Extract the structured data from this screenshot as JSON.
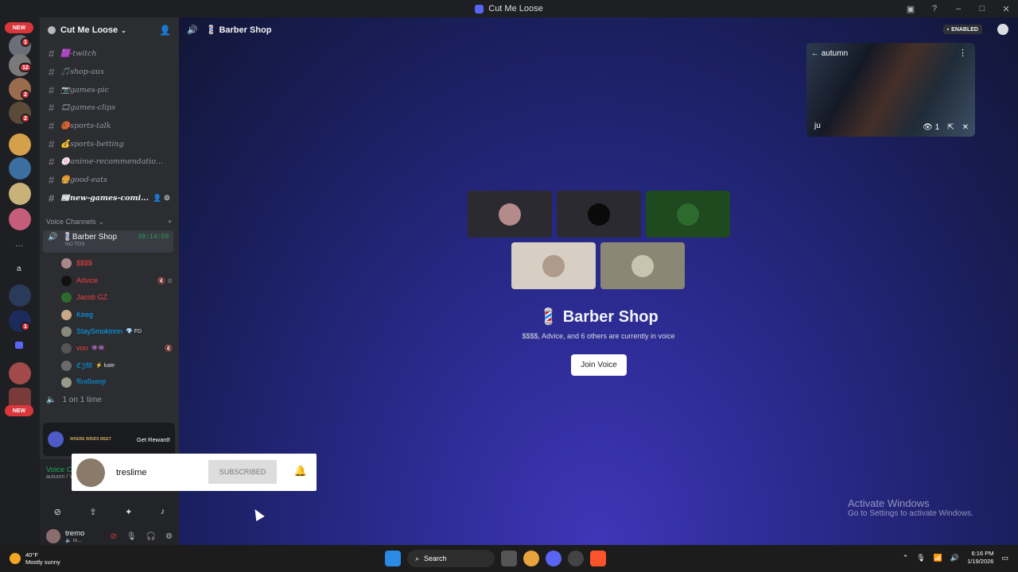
{
  "window": {
    "title": "Cut Me Loose"
  },
  "rail": {
    "new_top": "NEW",
    "new_bottom": "NEW",
    "badges": [
      "1",
      "12",
      "2",
      "2",
      "2",
      "1"
    ],
    "dm_label": "a"
  },
  "sidebar": {
    "server_name": "Cut Me Loose",
    "text_channels": [
      "🟪-twitch",
      "🎵shop-aux",
      "📷games-pic",
      "🎞games-clips",
      "🏀sports-talk",
      "💰sports-betting",
      "🍥anime-recommendatio...",
      "🍔good-eats",
      "📰new-games-comi..."
    ],
    "voice_category": "Voice Channels",
    "active_voice": {
      "name": "💈Barber Shop",
      "timer": "29:14:50",
      "status": "NO TOS"
    },
    "members": [
      {
        "name": "$$$$",
        "color": "#f23f43",
        "extra": ""
      },
      {
        "name": "Advice",
        "color": "#f23f43",
        "extra": ""
      },
      {
        "name": "Jacob GZ",
        "color": "#f23f43",
        "extra": ""
      },
      {
        "name": "Keeg",
        "color": "#00a8fc",
        "extra": ""
      },
      {
        "name": "StaySmokinnn",
        "color": "#00a8fc",
        "extra": "💎 FD"
      },
      {
        "name": "von",
        "color": "#f23f43",
        "extra": "👾👾"
      },
      {
        "name": "ℭ𝔍𝔐",
        "color": "#00a8fc",
        "extra": "⚡ kate"
      },
      {
        "name": "𝔑𝔢𝔞𝔩𝔩𝔶𝔞𝔫𝔤𝔦",
        "color": "#00a8fc",
        "extra": ""
      }
    ],
    "other_voice": "1 on 1 time",
    "promo": {
      "brand": "WHERE WINDS MEET",
      "cta": "Get Reward!"
    },
    "voice_connected": {
      "label": "Voice Conn",
      "sub": "autumn / Yes"
    },
    "user": {
      "name": "tremo",
      "status": "🔈 m..."
    }
  },
  "stage": {
    "header": "💈 Barber Shop",
    "enabled_badge": "ENABLED",
    "stream": {
      "title": "autumn",
      "user": "ju",
      "viewers": "1"
    },
    "voice_title": "💈 Barber Shop",
    "voice_desc": "$$$$, Advice, and 6 others are currently in voice",
    "join_label": "Join Voice",
    "watermark_title": "Activate Windows",
    "watermark_sub": "Go to Settings to activate Windows."
  },
  "popup": {
    "name": "treslime",
    "button": "SUBSCRIBED"
  },
  "taskbar": {
    "temp": "40°F",
    "weather": "Mostly sunny",
    "search": "Search",
    "time": "6:16 PM",
    "date": "1/19/2026"
  },
  "colors": {
    "accent": "#5865f2",
    "online": "#23a55a",
    "danger": "#da373c"
  }
}
